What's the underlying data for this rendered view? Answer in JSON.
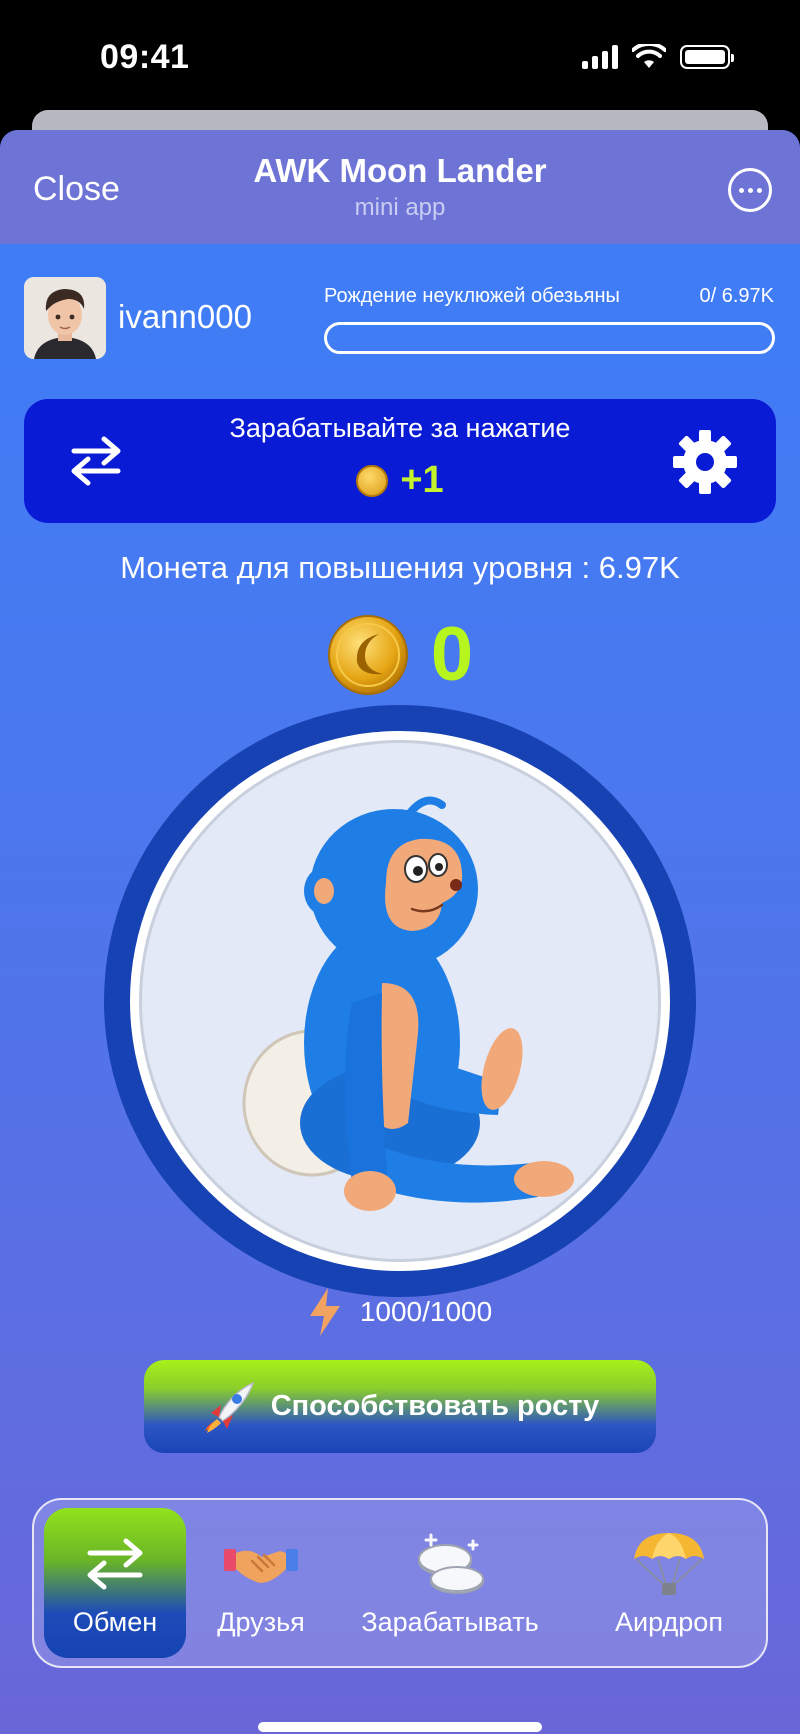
{
  "status": {
    "time": "09:41"
  },
  "header": {
    "close_label": "Close",
    "title": "AWK Moon Lander",
    "subtitle": "mini app"
  },
  "user": {
    "username": "ivann000",
    "level_title": "Рождение неуклюжей обезьяны",
    "level_progress_text": "0/ 6.97K",
    "level_progress": 0
  },
  "earn_card": {
    "title": "Зарабатывайте за нажатие",
    "amount": "+1"
  },
  "level_up_text": "Монета для повышения уровня : 6.97K",
  "balance": "0",
  "energy": "1000/1000",
  "boost": {
    "label": "Способствовать росту"
  },
  "nav": {
    "items": [
      {
        "label": "Обмен",
        "icon": "swap-icon",
        "active": true
      },
      {
        "label": "Друзья",
        "icon": "handshake-icon",
        "active": false
      },
      {
        "label": "Зарабатывать",
        "icon": "coins-icon",
        "active": false
      },
      {
        "label": "Аирдроп",
        "icon": "parachute-icon",
        "active": false
      }
    ]
  },
  "colors": {
    "accent_green": "#b6f51e",
    "card_blue": "#0a1bd6",
    "ring_blue": "#1742b3"
  }
}
